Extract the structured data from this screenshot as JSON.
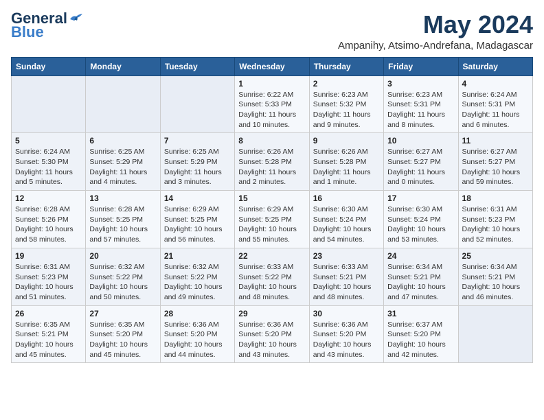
{
  "logo": {
    "line1": "General",
    "line2": "Blue"
  },
  "title": "May 2024",
  "subtitle": "Ampanihy, Atsimo-Andrefana, Madagascar",
  "days_of_week": [
    "Sunday",
    "Monday",
    "Tuesday",
    "Wednesday",
    "Thursday",
    "Friday",
    "Saturday"
  ],
  "weeks": [
    [
      {
        "day": "",
        "info": ""
      },
      {
        "day": "",
        "info": ""
      },
      {
        "day": "",
        "info": ""
      },
      {
        "day": "1",
        "info": "Sunrise: 6:22 AM\nSunset: 5:33 PM\nDaylight: 11 hours and 10 minutes."
      },
      {
        "day": "2",
        "info": "Sunrise: 6:23 AM\nSunset: 5:32 PM\nDaylight: 11 hours and 9 minutes."
      },
      {
        "day": "3",
        "info": "Sunrise: 6:23 AM\nSunset: 5:31 PM\nDaylight: 11 hours and 8 minutes."
      },
      {
        "day": "4",
        "info": "Sunrise: 6:24 AM\nSunset: 5:31 PM\nDaylight: 11 hours and 6 minutes."
      }
    ],
    [
      {
        "day": "5",
        "info": "Sunrise: 6:24 AM\nSunset: 5:30 PM\nDaylight: 11 hours and 5 minutes."
      },
      {
        "day": "6",
        "info": "Sunrise: 6:25 AM\nSunset: 5:29 PM\nDaylight: 11 hours and 4 minutes."
      },
      {
        "day": "7",
        "info": "Sunrise: 6:25 AM\nSunset: 5:29 PM\nDaylight: 11 hours and 3 minutes."
      },
      {
        "day": "8",
        "info": "Sunrise: 6:26 AM\nSunset: 5:28 PM\nDaylight: 11 hours and 2 minutes."
      },
      {
        "day": "9",
        "info": "Sunrise: 6:26 AM\nSunset: 5:28 PM\nDaylight: 11 hours and 1 minute."
      },
      {
        "day": "10",
        "info": "Sunrise: 6:27 AM\nSunset: 5:27 PM\nDaylight: 11 hours and 0 minutes."
      },
      {
        "day": "11",
        "info": "Sunrise: 6:27 AM\nSunset: 5:27 PM\nDaylight: 10 hours and 59 minutes."
      }
    ],
    [
      {
        "day": "12",
        "info": "Sunrise: 6:28 AM\nSunset: 5:26 PM\nDaylight: 10 hours and 58 minutes."
      },
      {
        "day": "13",
        "info": "Sunrise: 6:28 AM\nSunset: 5:25 PM\nDaylight: 10 hours and 57 minutes."
      },
      {
        "day": "14",
        "info": "Sunrise: 6:29 AM\nSunset: 5:25 PM\nDaylight: 10 hours and 56 minutes."
      },
      {
        "day": "15",
        "info": "Sunrise: 6:29 AM\nSunset: 5:25 PM\nDaylight: 10 hours and 55 minutes."
      },
      {
        "day": "16",
        "info": "Sunrise: 6:30 AM\nSunset: 5:24 PM\nDaylight: 10 hours and 54 minutes."
      },
      {
        "day": "17",
        "info": "Sunrise: 6:30 AM\nSunset: 5:24 PM\nDaylight: 10 hours and 53 minutes."
      },
      {
        "day": "18",
        "info": "Sunrise: 6:31 AM\nSunset: 5:23 PM\nDaylight: 10 hours and 52 minutes."
      }
    ],
    [
      {
        "day": "19",
        "info": "Sunrise: 6:31 AM\nSunset: 5:23 PM\nDaylight: 10 hours and 51 minutes."
      },
      {
        "day": "20",
        "info": "Sunrise: 6:32 AM\nSunset: 5:22 PM\nDaylight: 10 hours and 50 minutes."
      },
      {
        "day": "21",
        "info": "Sunrise: 6:32 AM\nSunset: 5:22 PM\nDaylight: 10 hours and 49 minutes."
      },
      {
        "day": "22",
        "info": "Sunrise: 6:33 AM\nSunset: 5:22 PM\nDaylight: 10 hours and 48 minutes."
      },
      {
        "day": "23",
        "info": "Sunrise: 6:33 AM\nSunset: 5:21 PM\nDaylight: 10 hours and 48 minutes."
      },
      {
        "day": "24",
        "info": "Sunrise: 6:34 AM\nSunset: 5:21 PM\nDaylight: 10 hours and 47 minutes."
      },
      {
        "day": "25",
        "info": "Sunrise: 6:34 AM\nSunset: 5:21 PM\nDaylight: 10 hours and 46 minutes."
      }
    ],
    [
      {
        "day": "26",
        "info": "Sunrise: 6:35 AM\nSunset: 5:21 PM\nDaylight: 10 hours and 45 minutes."
      },
      {
        "day": "27",
        "info": "Sunrise: 6:35 AM\nSunset: 5:20 PM\nDaylight: 10 hours and 45 minutes."
      },
      {
        "day": "28",
        "info": "Sunrise: 6:36 AM\nSunset: 5:20 PM\nDaylight: 10 hours and 44 minutes."
      },
      {
        "day": "29",
        "info": "Sunrise: 6:36 AM\nSunset: 5:20 PM\nDaylight: 10 hours and 43 minutes."
      },
      {
        "day": "30",
        "info": "Sunrise: 6:36 AM\nSunset: 5:20 PM\nDaylight: 10 hours and 43 minutes."
      },
      {
        "day": "31",
        "info": "Sunrise: 6:37 AM\nSunset: 5:20 PM\nDaylight: 10 hours and 42 minutes."
      },
      {
        "day": "",
        "info": ""
      }
    ]
  ]
}
